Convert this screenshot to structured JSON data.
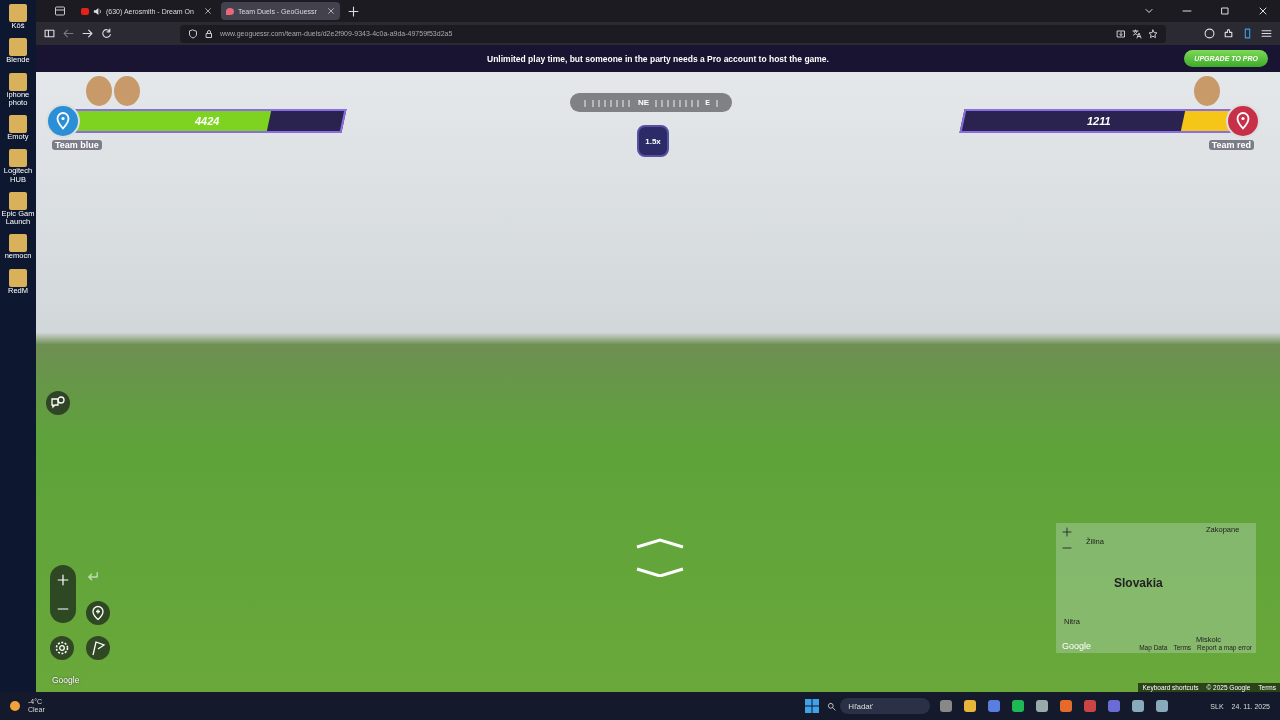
{
  "desktop_icons": [
    {
      "label": "Kôš"
    },
    {
      "label": "Blende"
    },
    {
      "label": "iphone photo"
    },
    {
      "label": "Emoty"
    },
    {
      "label": "Logitech HUB"
    },
    {
      "label": "Epic Gam Launch"
    },
    {
      "label": "nemocn"
    },
    {
      "label": "RedM"
    }
  ],
  "browser": {
    "tabs": [
      {
        "title": "(630) Aerosmith - Dream On",
        "selected": false,
        "audio": true
      },
      {
        "title": "Team Duels - GeoGuessr",
        "selected": true,
        "audio": false
      }
    ],
    "url": "www.geoguessr.com/team-duels/d2e2f909-9343-4c0a-a9da-49759f53d2a5"
  },
  "banner": {
    "text": "Unlimited play time, but someone in the party needs a Pro account to host the game.",
    "button": "UPGRADE TO PRO"
  },
  "teams": [
    {
      "name": "Team blue",
      "score": "4424",
      "level": 0.73,
      "kind": "left",
      "color": "#2b8fd8"
    },
    {
      "name": "Team red",
      "score": "1211",
      "level": 0.19,
      "kind": "right",
      "color": "#c8304a"
    }
  ],
  "compass": {
    "marks": [
      "NE",
      "E"
    ]
  },
  "multiplier": "1.5x",
  "map": {
    "country": "Slovakia",
    "places": [
      "Žilina",
      "Zakopane",
      "Nitra",
      "Miskolc"
    ],
    "footer": [
      "Map Data",
      "Terms",
      "Report a map error"
    ],
    "logo": "Google"
  },
  "attribution": {
    "logo": "Google",
    "links": [
      "Keyboard shortcuts",
      "© 2025 Google",
      "Terms"
    ]
  },
  "taskbar": {
    "temp": "-4°C",
    "condition": "Clear",
    "search_placeholder": "Hľadať",
    "language": "SLK",
    "date": "24. 11. 2025"
  }
}
